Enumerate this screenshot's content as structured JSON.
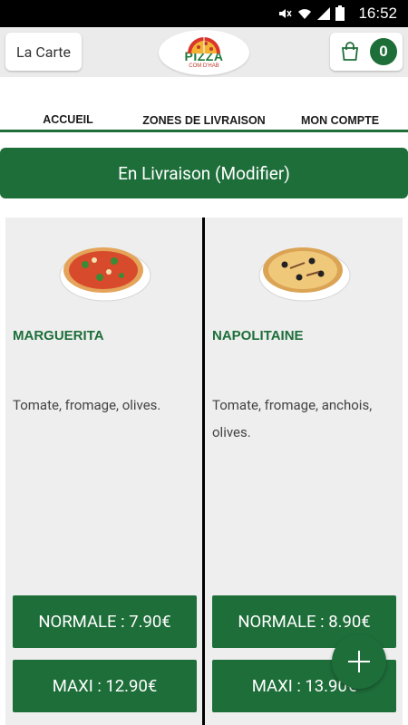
{
  "status_bar": {
    "time": "16:52",
    "icons": [
      "mute-icon",
      "wifi-icon",
      "signal-icon",
      "battery-icon"
    ]
  },
  "header": {
    "menu_button_label": "La Carte",
    "logo": {
      "word": "PIZZA",
      "sub": "COM D'HAB"
    },
    "cart_count": "0"
  },
  "tabs": [
    {
      "label": "ACCUEIL",
      "active": true
    },
    {
      "label": "ZONES DE LIVRAISON",
      "active": false
    },
    {
      "label": "MON COMPTE",
      "active": false
    }
  ],
  "delivery_button_label": "En Livraison (Modifier)",
  "products": [
    {
      "name": "MARGUERITA",
      "description": "Tomate, fromage, olives.",
      "prices": [
        "NORMALE : 7.90€",
        "MAXI : 12.90€"
      ]
    },
    {
      "name": "NAPOLITAINE",
      "description": "Tomate, fromage, anchois, olives.",
      "prices": [
        "NORMALE : 8.90€",
        "MAXI : 13.90€"
      ]
    }
  ],
  "colors": {
    "brand_green": "#1e6e3a",
    "card_bg": "#eeeeee",
    "topbar_bg": "#ebebeb"
  }
}
